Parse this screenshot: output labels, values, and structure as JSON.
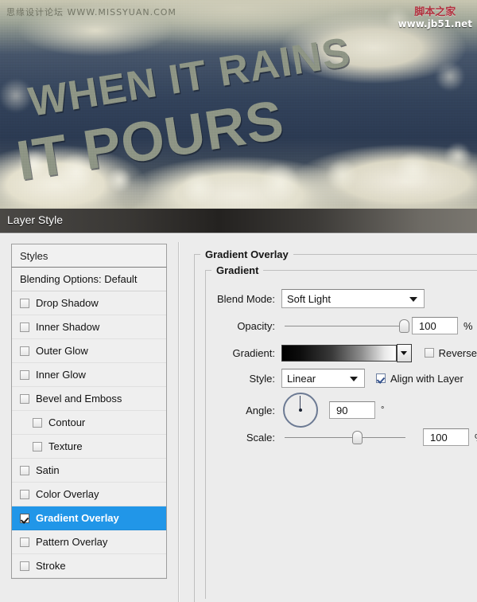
{
  "artwork": {
    "headline_line1": "WHEN IT RAINS",
    "headline_line2": "IT POURS",
    "watermark_left": "思缘设计论坛  WWW.MISSYUAN.COM",
    "watermark_right_cn": "脚本之家",
    "watermark_right_url": "www.jb51.net"
  },
  "dialog": {
    "title": "Layer Style"
  },
  "styles_panel": {
    "header": "Styles",
    "blending_options": "Blending Options: Default",
    "items": [
      {
        "label": "Drop Shadow",
        "checked": false,
        "indent": false,
        "selected": false
      },
      {
        "label": "Inner Shadow",
        "checked": false,
        "indent": false,
        "selected": false
      },
      {
        "label": "Outer Glow",
        "checked": false,
        "indent": false,
        "selected": false
      },
      {
        "label": "Inner Glow",
        "checked": false,
        "indent": false,
        "selected": false
      },
      {
        "label": "Bevel and Emboss",
        "checked": false,
        "indent": false,
        "selected": false
      },
      {
        "label": "Contour",
        "checked": false,
        "indent": true,
        "selected": false
      },
      {
        "label": "Texture",
        "checked": false,
        "indent": true,
        "selected": false
      },
      {
        "label": "Satin",
        "checked": false,
        "indent": false,
        "selected": false
      },
      {
        "label": "Color Overlay",
        "checked": false,
        "indent": false,
        "selected": false
      },
      {
        "label": "Gradient Overlay",
        "checked": true,
        "indent": false,
        "selected": true
      },
      {
        "label": "Pattern Overlay",
        "checked": false,
        "indent": false,
        "selected": false
      },
      {
        "label": "Stroke",
        "checked": false,
        "indent": false,
        "selected": false
      }
    ]
  },
  "settings": {
    "section_title": "Gradient Overlay",
    "group_title": "Gradient",
    "blend_mode": {
      "label": "Blend Mode:",
      "value": "Soft Light"
    },
    "opacity": {
      "label": "Opacity:",
      "value": "100",
      "unit": "%",
      "percent": 100
    },
    "gradient": {
      "label": "Gradient:",
      "from": "#000000",
      "to": "#ffffff"
    },
    "reverse": {
      "label": "Reverse",
      "checked": false
    },
    "style": {
      "label": "Style:",
      "value": "Linear"
    },
    "align_with_layer": {
      "label": "Align with Layer",
      "checked": true
    },
    "angle": {
      "label": "Angle:",
      "value": "90",
      "unit": "°",
      "degrees": 90
    },
    "scale": {
      "label": "Scale:",
      "value": "100",
      "unit": "%",
      "percent": 60
    }
  },
  "colors": {
    "selection_blue": "#2196e8",
    "dialog_bg": "#ececec",
    "titlebar_dark": "#242220"
  }
}
